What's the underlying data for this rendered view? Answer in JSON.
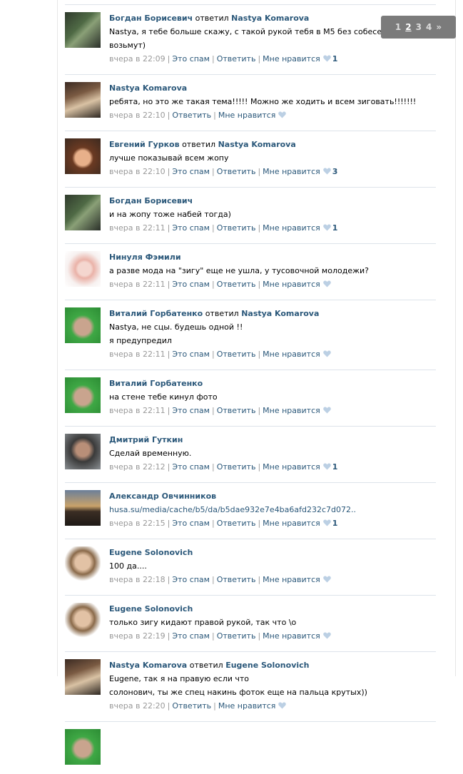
{
  "pager": {
    "pages": [
      "1",
      "2",
      "3",
      "4"
    ],
    "current": "2",
    "next": "»"
  },
  "actions": {
    "spam": "Это спам",
    "reply": "Ответить",
    "like": "Мне нравится"
  },
  "comments": [
    {
      "author": "Богдан Борисевич",
      "replied": "ответил",
      "reply_to": "Nastya Komarova",
      "lines": [
        "Nastya, я тебе больше скажу, с такой рукой тебя в М5 без собеседования возьмут)"
      ],
      "time": "вчера в 22:09",
      "likes": "1"
    },
    {
      "author": "Nastya Komarova",
      "replied": "",
      "reply_to": "",
      "lines": [
        "ребята, но это же такая тема!!!!! Можно же ходить и всем зиговать!!!!!!!"
      ],
      "time": "вчера в 22:10",
      "likes": ""
    },
    {
      "author": "Евгений Гурков",
      "replied": "ответил",
      "reply_to": "Nastya Komarova",
      "lines": [
        "лучше показывай всем жопу"
      ],
      "time": "вчера в 22:10",
      "likes": "3"
    },
    {
      "author": "Богдан Борисевич",
      "replied": "",
      "reply_to": "",
      "lines": [
        "и на жопу тоже набей тогда)"
      ],
      "time": "вчера в 22:11",
      "likes": "1"
    },
    {
      "author": "Нинуля Фэмили",
      "replied": "",
      "reply_to": "",
      "lines": [
        "а разве мода на \"зигу\" еще не ушла, у тусовочной молодежи?"
      ],
      "time": "вчера в 22:11",
      "likes": ""
    },
    {
      "author": "Виталий Горбатенко",
      "replied": "ответил",
      "reply_to": "Nastya Komarova",
      "lines": [
        "Nastya, не сцы. будешь одной !!",
        "я предупредил"
      ],
      "time": "вчера в 22:11",
      "likes": ""
    },
    {
      "author": "Виталий Горбатенко",
      "replied": "",
      "reply_to": "",
      "lines": [
        "на стене тебе кинул фото"
      ],
      "time": "вчера в 22:11",
      "likes": ""
    },
    {
      "author": "Дмитрий Гуткин",
      "replied": "",
      "reply_to": "",
      "lines": [
        "Сделай временную."
      ],
      "time": "вчера в 22:12",
      "likes": "1"
    },
    {
      "author": "Александр Овчинников",
      "replied": "",
      "reply_to": "",
      "link": "husa.su/media/cache/b5/da/b5dae932e7e4ba6afd232c7d072..",
      "time": "вчера в 22:15",
      "likes": "1"
    },
    {
      "author": "Eugene Solonovich",
      "replied": "",
      "reply_to": "",
      "lines": [
        "100 да...."
      ],
      "time": "вчера в 22:18",
      "likes": ""
    },
    {
      "author": "Eugene Solonovich",
      "replied": "",
      "reply_to": "",
      "lines": [
        "только зигу кидают правой рукой, так что \\o"
      ],
      "time": "вчера в 22:19",
      "likes": ""
    },
    {
      "author": "Nastya Komarova",
      "replied": "ответил",
      "reply_to": "Eugene Solonovich",
      "lines": [
        "Eugene, так я на правую если что",
        "солонович, ты же спец накинь фоток еще на пальца крутых))"
      ],
      "time": "вчера в 22:20",
      "likes": ""
    }
  ]
}
